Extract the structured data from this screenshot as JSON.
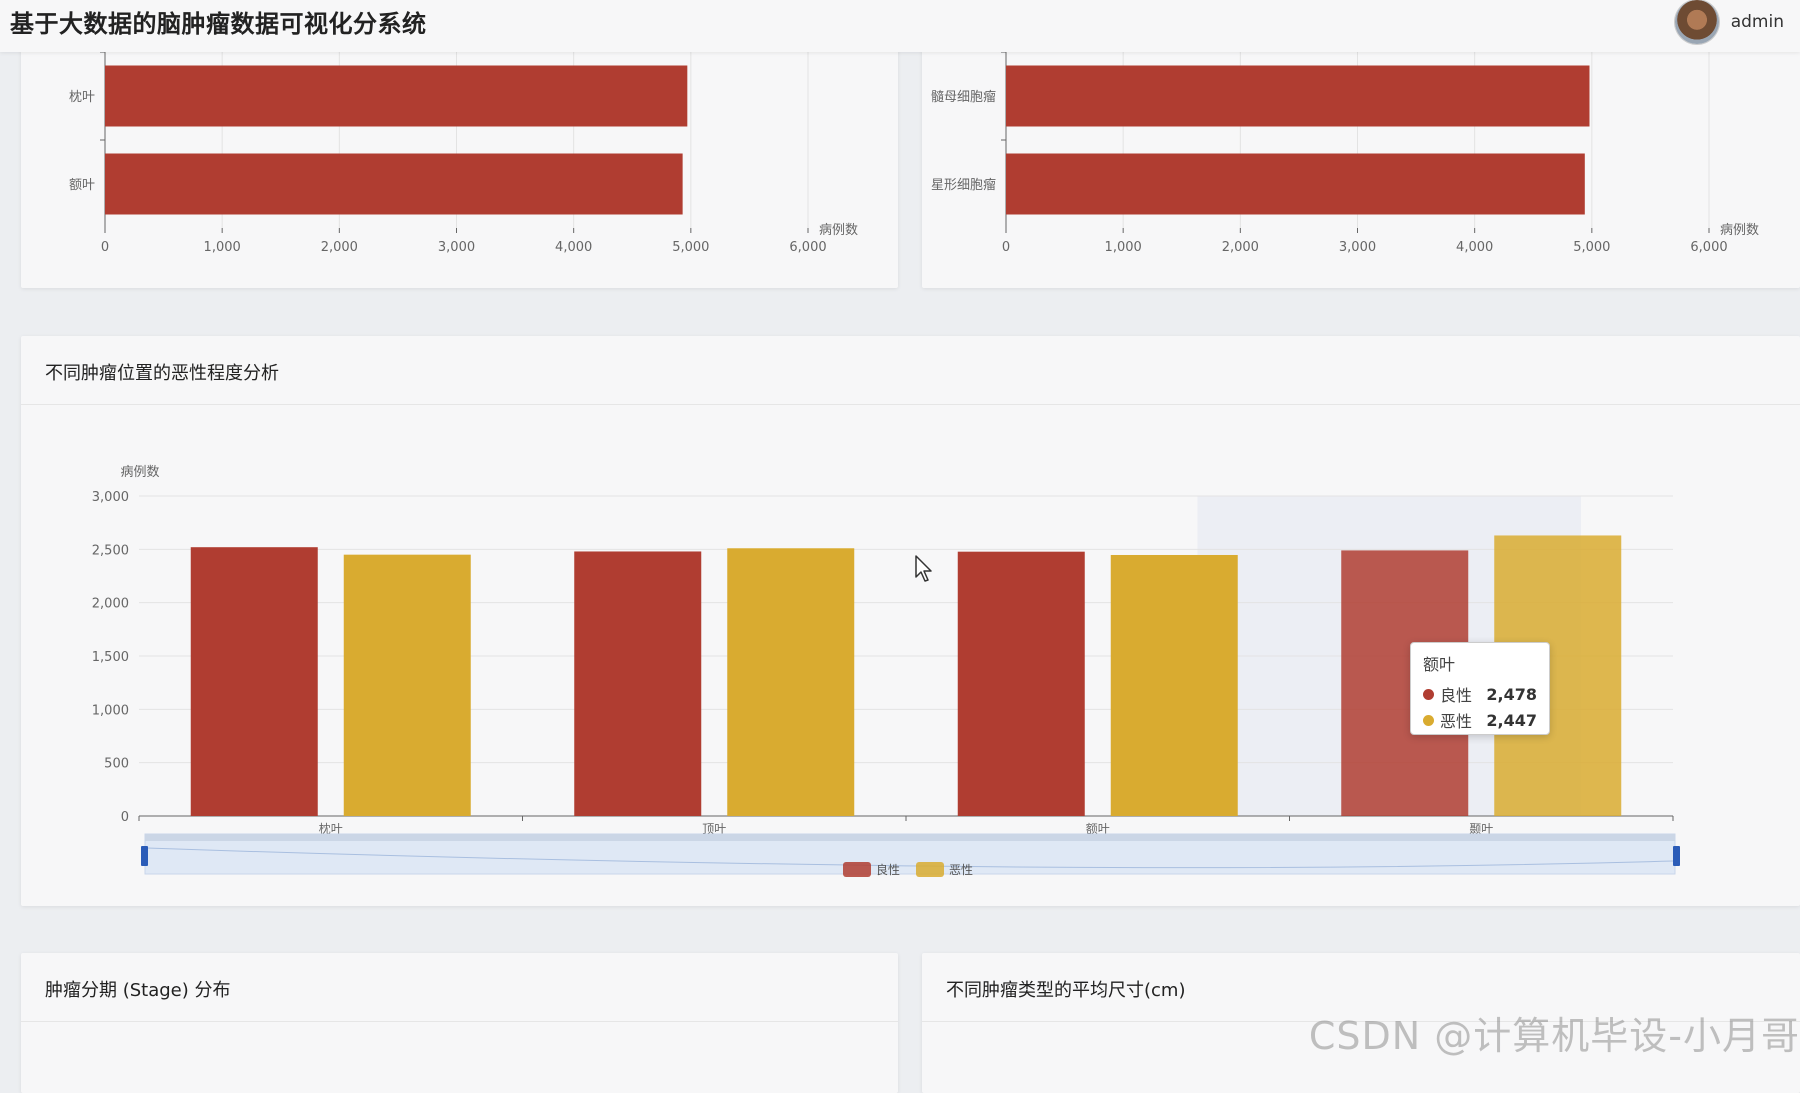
{
  "header": {
    "title": "基于大数据的脑肿瘤数据可视化分系统",
    "user": "admin"
  },
  "chart_data": [
    {
      "type": "bar",
      "orientation": "horizontal",
      "categories": [
        "额叶",
        "枕叶"
      ],
      "values": [
        4930,
        4970
      ],
      "xlabel": "病例数",
      "xlim": [
        0,
        6000
      ],
      "xticks": [
        "0",
        "1,000",
        "2,000",
        "3,000",
        "4,000",
        "5,000",
        "6,000"
      ],
      "color": "#b03d31"
    },
    {
      "type": "bar",
      "orientation": "horizontal",
      "categories": [
        "星形细胞瘤",
        "髓母细胞瘤"
      ],
      "values": [
        4940,
        4980
      ],
      "xlabel": "病例数",
      "xlim": [
        0,
        6000
      ],
      "xticks": [
        "0",
        "1,000",
        "2,000",
        "3,000",
        "4,000",
        "5,000",
        "6,000"
      ],
      "color": "#b03d31"
    },
    {
      "type": "bar",
      "title": "不同肿瘤位置的恶性程度分析",
      "categories": [
        "枕叶",
        "顶叶",
        "额叶",
        "颞叶"
      ],
      "series": [
        {
          "name": "良性",
          "values": [
            2520,
            2480,
            2478,
            2490
          ],
          "color": "#b03d31"
        },
        {
          "name": "恶性",
          "values": [
            2450,
            2510,
            2447,
            2630
          ],
          "color": "#d9ab30"
        }
      ],
      "ylabel": "病例数",
      "ylim": [
        0,
        3000
      ],
      "yticks": [
        "0",
        "500",
        "1,000",
        "1,500",
        "2,000",
        "2,500",
        "3,000"
      ],
      "legend": "bottom"
    }
  ],
  "tooltip": {
    "title": "额叶",
    "rows": [
      {
        "name": "良性",
        "value": "2,478",
        "color": "#b03d31"
      },
      {
        "name": "恶性",
        "value": "2,447",
        "color": "#d9ab30"
      }
    ]
  },
  "cards": {
    "stage_title": "肿瘤分期 (Stage) 分布",
    "size_title": "不同肿瘤类型的平均尺寸(cm)"
  },
  "watermark": "CSDN @计算机毕设-小月哥"
}
